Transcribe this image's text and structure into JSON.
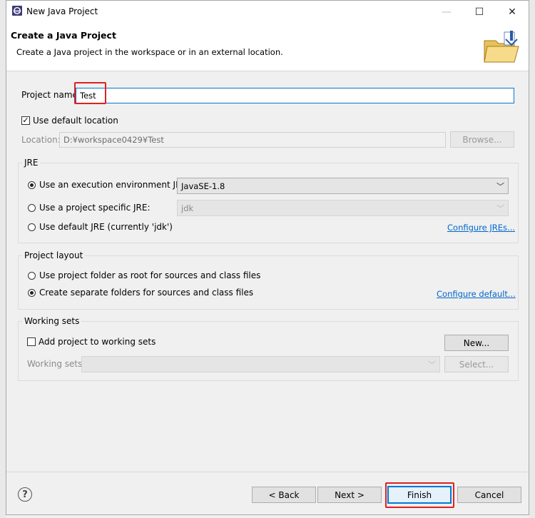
{
  "window": {
    "title": "New Java Project",
    "minimize": "—",
    "maximize": "☐",
    "close": "✕"
  },
  "header": {
    "title": "Create a Java Project",
    "description": "Create a Java project in the workspace or in an external location."
  },
  "project_name": {
    "label": "Project name:",
    "value": "Test"
  },
  "default_location": {
    "label": "Use default location",
    "checked": true
  },
  "location": {
    "label": "Location:",
    "value": "D:¥workspace0429¥Test",
    "browse_label": "Browse..."
  },
  "jre": {
    "title": "JRE",
    "option_env": "Use an execution environment JRE:",
    "env_value": "JavaSE-1.8",
    "option_specific": "Use a project specific JRE:",
    "specific_value": "jdk",
    "option_default": "Use default JRE (currently 'jdk')",
    "configure_link": "Configure JREs..."
  },
  "layout": {
    "title": "Project layout",
    "option_root": "Use project folder as root for sources and class files",
    "option_separate": "Create separate folders for sources and class files",
    "configure_link": "Configure default..."
  },
  "working_sets": {
    "title": "Working sets",
    "add_label": "Add project to working sets",
    "new_label": "New...",
    "sets_label": "Working sets:",
    "select_label": "Select..."
  },
  "footer": {
    "help": "?",
    "back": "< Back",
    "next": "Next >",
    "finish": "Finish",
    "cancel": "Cancel"
  },
  "colors": {
    "accent": "#0078d7",
    "highlight": "#e02020",
    "link": "#0066cc"
  }
}
